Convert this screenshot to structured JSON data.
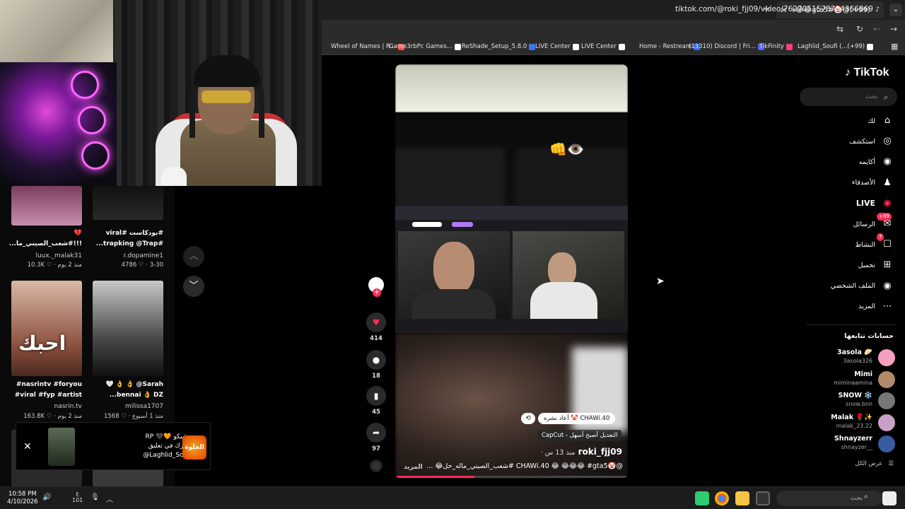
{
  "browser": {
    "tab_title": "(99+)@🤡#gta5😂😂😂😂",
    "url": "tiktok.com/@roki_fjj09/video/7627051578704366869",
    "bookmarks": [
      {
        "label": "Wheel of Names | R...",
        "color": "#ff4f4f"
      },
      {
        "label": "Game3rbPc Games...",
        "color": "#ffffff"
      },
      {
        "label": "ReShade_Setup_5.8.0",
        "color": "#3a76f0"
      },
      {
        "label": "LIVE Center",
        "color": "#ffffff"
      },
      {
        "label": "LIVE Center",
        "color": "#ffffff"
      },
      {
        "label": "Home - Restream",
        "color": "#3a6df0"
      },
      {
        "label": "(13310) Discord | Fri...",
        "color": "#5865f2"
      },
      {
        "label": "TikFinity",
        "color": "#ff3b7f"
      },
      {
        "label": "Laghlid_Soufi (...(+99)",
        "color": "#ffffff"
      }
    ]
  },
  "grid": {
    "items": [
      {
        "caption": "💔\n!!!#شعب_الصيني_ما...",
        "author": "luux._malak31",
        "meta": "منذ 2 يوم · ♡ 10.3K"
      },
      {
        "caption": "#بودكاست #viral\n#trapking @Trap...",
        "author": "r.dopamine1",
        "meta": "3-30 · ♡ 4786"
      },
      {
        "caption": "#nasrintv #foryou\n#viral #fyp #artist",
        "author": "nasrin.tv",
        "meta": "منذ 2 يوم · ♡ 163.8K"
      },
      {
        "caption": "🤍 👌 👌 @Sarah\n...bennai 👌 DZ",
        "author": "milissa1707",
        "meta": "منذ 1 أسبوع · ♡ 1568"
      }
    ],
    "overlay_text": "احبك"
  },
  "toast": {
    "line1": "RP 🖤🧡 شيكو..",
    "line2": "ذكرك في تعليق:",
    "line3": "@Laghlid_Soufi",
    "logo_text": "الحلوة"
  },
  "video": {
    "repost_label": "أعاد نشره 🤡 CHAWi.40",
    "capcut": "CapCut - التعديل أصبح أسهل",
    "username": "roki_fjj09",
    "time": "· منذ 13 س",
    "description": "@🤡CHAWi.40 😂 😂😂😂 #gta5 #شعب_الصيني_ماله_حل😂 ...",
    "more": "المزيد",
    "progress": 0.34,
    "emoji": "👊👁️"
  },
  "actions": {
    "likes": "414",
    "comments": "18",
    "saves": "45",
    "shares": "97"
  },
  "sidebar": {
    "logo": "TikTok",
    "search_placeholder": "بحث",
    "nav": [
      {
        "label": "لك",
        "icon": "home-icon",
        "glyph": "⌂"
      },
      {
        "label": "استكشف",
        "icon": "compass-icon",
        "glyph": "◎"
      },
      {
        "label": "أكايمه",
        "icon": "avatar-icon",
        "glyph": "◉"
      },
      {
        "label": "الأصدقاء",
        "icon": "friends-icon",
        "glyph": "♟"
      },
      {
        "label": "LIVE",
        "icon": "live-icon",
        "glyph": "◉"
      },
      {
        "label": "الرسائل",
        "icon": "messages-icon",
        "glyph": "✉",
        "badge": "99+"
      },
      {
        "label": "النشاط",
        "icon": "activity-icon",
        "glyph": "☐",
        "badge": "7"
      },
      {
        "label": "تحميل",
        "icon": "upload-icon",
        "glyph": "⊞"
      },
      {
        "label": "الملف الشخصي",
        "icon": "profile-icon",
        "glyph": "◉"
      },
      {
        "label": "المزيد",
        "icon": "more-icon",
        "glyph": "⋯"
      }
    ],
    "following_title": "حسابات تتابعها",
    "following": [
      {
        "name": "3asola 🥟",
        "handle": "3asola326",
        "color": "#f3a0c0"
      },
      {
        "name": "Mimi",
        "handle": "miminaamina",
        "color": "#b08a6a"
      },
      {
        "name": "SNOW ❄️",
        "handle": "snow.bnn",
        "color": "#777"
      },
      {
        "name": "Malak 🌹✨",
        "handle": "malak_23.22",
        "color": "#c9a0c8"
      },
      {
        "name": "Shnayzerr",
        "handle": "shnayzer__",
        "color": "#3a5aa0"
      }
    ],
    "see_all": "عرض الكل"
  },
  "taskbar": {
    "time": "10:58 PM",
    "date": "4/10/2026",
    "lang": "ع",
    "lang_sub": "101",
    "search_placeholder": "بحث"
  }
}
